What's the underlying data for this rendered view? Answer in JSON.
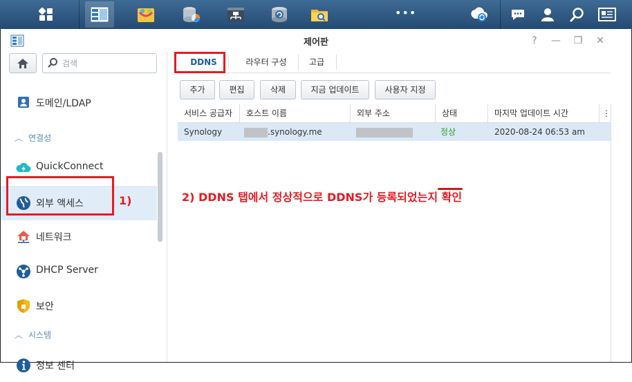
{
  "taskbar": {
    "icons": [
      "main-menu-icon",
      "control-panel-icon",
      "package-center-icon",
      "storage-manager-icon",
      "network-icon",
      "backup-icon",
      "file-station-icon",
      "more-icon",
      "sync-icon",
      "chat-icon",
      "user-icon",
      "search-icon",
      "info-icon"
    ],
    "more_label": "•••"
  },
  "window": {
    "title": "제어판",
    "controls": {
      "help": "?",
      "minimize": "—",
      "restore": "❐",
      "close": "✕"
    }
  },
  "sidebar": {
    "search_placeholder": "검색",
    "items": [
      {
        "label": "도메인/LDAP",
        "icon": "domain-icon"
      },
      {
        "label": "QuickConnect",
        "icon": "quickconnect-icon"
      },
      {
        "label": "외부 액세스",
        "icon": "external-access-icon",
        "selected": true
      },
      {
        "label": "네트워크",
        "icon": "network-icon"
      },
      {
        "label": "DHCP Server",
        "icon": "dhcp-server-icon"
      },
      {
        "label": "보안",
        "icon": "security-icon"
      },
      {
        "label": "정보 센터",
        "icon": "info-center-icon"
      }
    ],
    "sections": {
      "connectivity": "연결성",
      "system": "시스템"
    }
  },
  "tabs": [
    "DDNS",
    "라우터 구성",
    "고급"
  ],
  "toolbar": [
    "추가",
    "편집",
    "삭제",
    "지금 업데이트",
    "사용자 지정"
  ],
  "grid": {
    "columns": [
      "서비스 공급자",
      "호스트 이름",
      "외부 주소",
      "상태",
      "마지막 업데이트 시간"
    ],
    "rows": [
      {
        "provider": "Synology",
        "hostname_suffix": ".synology.me",
        "status": "정상",
        "last_update": "2020-08-24 06:53 am"
      }
    ],
    "column_menu": "⋮"
  },
  "annotations": {
    "step1": "1)",
    "step2": "2) DDNS 탭에서 정상적으로 DDNS가 등록되었는지 확인"
  },
  "colors": {
    "annotation": "#e31b23",
    "status_ok": "#2f9a1e",
    "selected_row": "#dbe9f7"
  }
}
